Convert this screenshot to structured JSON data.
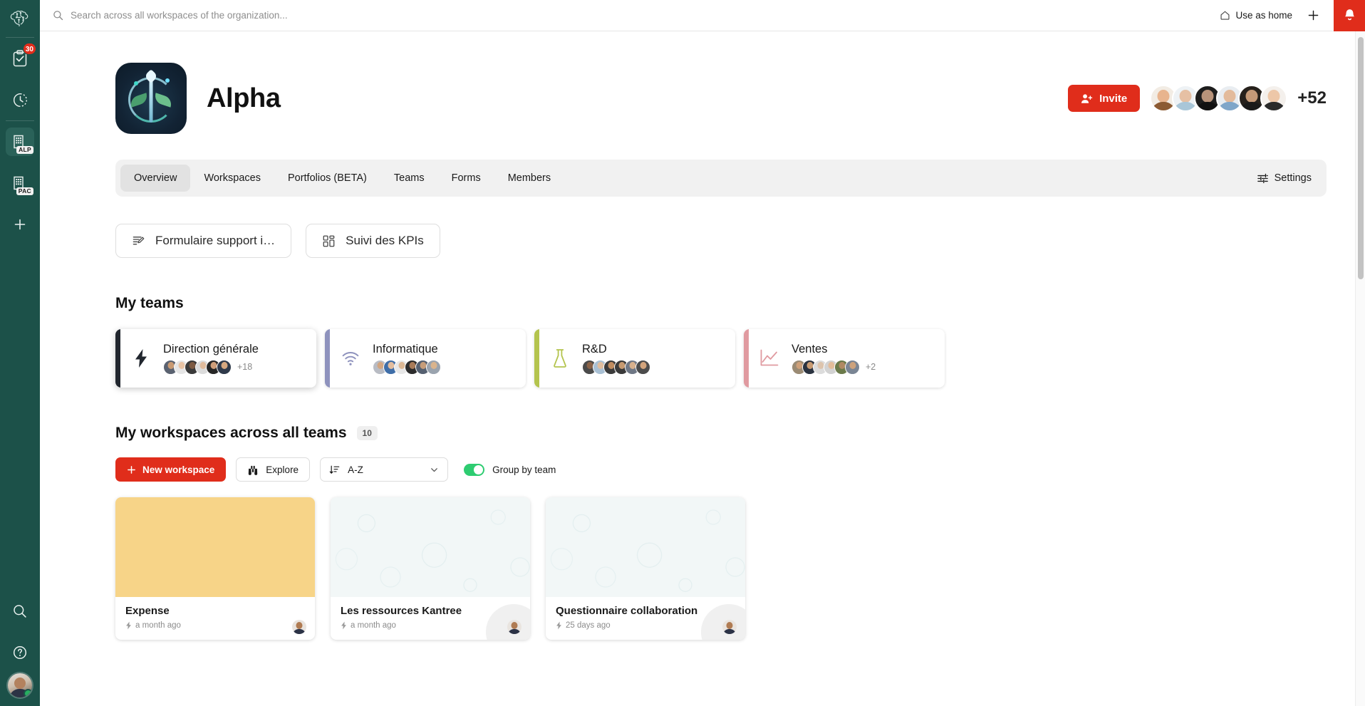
{
  "rail": {
    "logo_icon": "brain-network-logo",
    "items": [
      {
        "name": "tasks",
        "icon": "clipboard-check-icon",
        "badge": "30",
        "active": false
      },
      {
        "name": "recent",
        "icon": "clock-history-icon",
        "badge": "",
        "active": false
      },
      {
        "name": "org-alpha",
        "icon": "building-icon",
        "tag": "ALP",
        "active": true
      },
      {
        "name": "org-pac",
        "icon": "building-icon",
        "tag": "PAC",
        "active": false
      },
      {
        "name": "add-organization",
        "icon": "plus-icon",
        "active": false
      }
    ],
    "bottom": [
      {
        "name": "search",
        "icon": "search-icon"
      },
      {
        "name": "help",
        "icon": "question-circle-icon"
      }
    ],
    "avatar_name": "user-avatar",
    "status": "online"
  },
  "topbar": {
    "search_placeholder": "Search across all workspaces of the organization...",
    "search_value": "",
    "search_icon": "search-icon",
    "use_as_home_label": "Use as home",
    "home_icon": "home-icon",
    "plus_icon": "plus-icon",
    "bell_icon": "bell-icon",
    "bell_bg": "#e02d1b"
  },
  "org": {
    "title": "Alpha",
    "logo_icon": "alpha-org-logo",
    "invite_label": "Invite",
    "invite_icon": "person-add-icon",
    "invite_color": "#e02d1b",
    "member_overflow": "+52",
    "avatars": [
      {
        "name": "member-avatar-1",
        "skin": "#e8b48e",
        "hair": "#c79a52",
        "shirt": "#8c5a32"
      },
      {
        "name": "member-avatar-2",
        "skin": "#e6c0a4",
        "hair": "#e8e8e8",
        "shirt": "#a9c6d8"
      },
      {
        "name": "member-avatar-3",
        "skin": "#b8937a",
        "hair": "#9b9b9b",
        "shirt": "#1d1d1d"
      },
      {
        "name": "member-avatar-4",
        "skin": "#e3bb9c",
        "hair": "#d8d8d8",
        "shirt": "#7fa6c9"
      },
      {
        "name": "member-avatar-5",
        "skin": "#c59a78",
        "hair": "#4b3a2c",
        "shirt": "#1a1a1a"
      },
      {
        "name": "member-avatar-6",
        "skin": "#edc7a8",
        "hair": "#efe3c8",
        "shirt": "#2a2a2a"
      }
    ]
  },
  "tabs": [
    {
      "label": "Overview",
      "active": true
    },
    {
      "label": "Workspaces",
      "active": false
    },
    {
      "label": "Portfolios (BETA)",
      "active": false
    },
    {
      "label": "Teams",
      "active": false
    },
    {
      "label": "Forms",
      "active": false
    },
    {
      "label": "Members",
      "active": false
    }
  ],
  "settings": {
    "label": "Settings",
    "icon": "sliders-icon"
  },
  "shortcuts": [
    {
      "label": "Formulaire support i…",
      "icon": "form-edit-icon"
    },
    {
      "label": "Suivi des KPIs",
      "icon": "dashboard-grid-icon"
    }
  ],
  "my_teams": {
    "heading": "My teams",
    "cards": [
      {
        "name": "Direction générale",
        "icon": "lightning-bolt-icon",
        "bar_color": "#21262e",
        "icon_color": "#21262e",
        "more": "+18",
        "selected": true,
        "avatars": [
          {
            "skin": "#c99a72",
            "shirt": "#5a6270"
          },
          {
            "skin": "#e8c3a4",
            "shirt": "#e6e6e6"
          },
          {
            "skin": "#7d5a42",
            "shirt": "#3a3a3a"
          },
          {
            "skin": "#e0bb9c",
            "shirt": "#dcdcdc"
          },
          {
            "skin": "#cf9f7a",
            "shirt": "#262626"
          },
          {
            "skin": "#d6a87f",
            "shirt": "#2f3a4a"
          }
        ]
      },
      {
        "name": "Informatique",
        "icon": "wifi-icon",
        "bar_color": "#8e92bd",
        "icon_color": "#8e92bd",
        "more": "",
        "selected": false,
        "avatars": [
          {
            "skin": "#d2a580",
            "shirt": "#b9bcc4"
          },
          {
            "skin": "#e3bd9e",
            "shirt": "#3f6ea8"
          },
          {
            "skin": "#dcb894",
            "shirt": "#e8e8e8"
          },
          {
            "skin": "#a87b58",
            "shirt": "#2c2c2c"
          },
          {
            "skin": "#c79d79",
            "shirt": "#556070"
          },
          {
            "skin": "#dab48d",
            "shirt": "#9aa3ae"
          }
        ]
      },
      {
        "name": "R&D",
        "icon": "flask-icon",
        "bar_color": "#b4c44e",
        "icon_color": "#b4c44e",
        "more": "",
        "selected": false,
        "avatars": [
          {
            "skin": "#8a6247",
            "shirt": "#4a4a4a"
          },
          {
            "skin": "#e0bd9e",
            "shirt": "#a9c0d4"
          },
          {
            "skin": "#c08c5f",
            "shirt": "#3b3b3b"
          },
          {
            "skin": "#c79a70",
            "shirt": "#3a3a3a"
          },
          {
            "skin": "#d8b18d",
            "shirt": "#6f7785"
          },
          {
            "skin": "#d3a47c",
            "shirt": "#4c4c4c"
          }
        ]
      },
      {
        "name": "Ventes",
        "icon": "line-chart-icon",
        "bar_color": "#e09aa0",
        "icon_color": "#e09aa0",
        "more": "+2",
        "selected": false,
        "avatars": [
          {
            "skin": "#cfa079",
            "shirt": "#9b8b74"
          },
          {
            "skin": "#c99b72",
            "shirt": "#2b3340"
          },
          {
            "skin": "#ddc4ad",
            "shirt": "#dcdcdc"
          },
          {
            "skin": "#e3bc9a",
            "shirt": "#d2d2d2"
          },
          {
            "skin": "#b08a63",
            "shirt": "#6b7a4a"
          },
          {
            "skin": "#cda27c",
            "shirt": "#7a8594"
          }
        ]
      }
    ]
  },
  "my_workspaces": {
    "heading": "My workspaces across all teams",
    "count": "10",
    "new_button": {
      "label": "New workspace",
      "icon": "plus-icon",
      "color": "#e02d1b"
    },
    "explore_button": {
      "label": "Explore",
      "icon": "binoculars-icon"
    },
    "sort": {
      "value": "A-Z",
      "icon": "sort-descending-icon",
      "chevron": "chevron-down-icon"
    },
    "group_toggle": {
      "label": "Group by team",
      "on": true,
      "color": "#2ecc71"
    },
    "cards": [
      {
        "title": "Expense",
        "meta": "a month ago",
        "meta_icon": "lightning-bolt-icon",
        "cover_type": "solid",
        "cover_color": "#f7d488",
        "owner": "owner-avatar"
      },
      {
        "title": "Les ressources Kantree",
        "meta": "a month ago",
        "meta_icon": "lightning-bolt-icon",
        "cover_type": "pattern",
        "cover_color": "#f2f7f7",
        "owner": "owner-avatar"
      },
      {
        "title": "Questionnaire collaboration",
        "meta": "25 days ago",
        "meta_icon": "lightning-bolt-icon",
        "cover_type": "pattern",
        "cover_color": "#f2f7f7",
        "owner": "owner-avatar"
      }
    ]
  }
}
